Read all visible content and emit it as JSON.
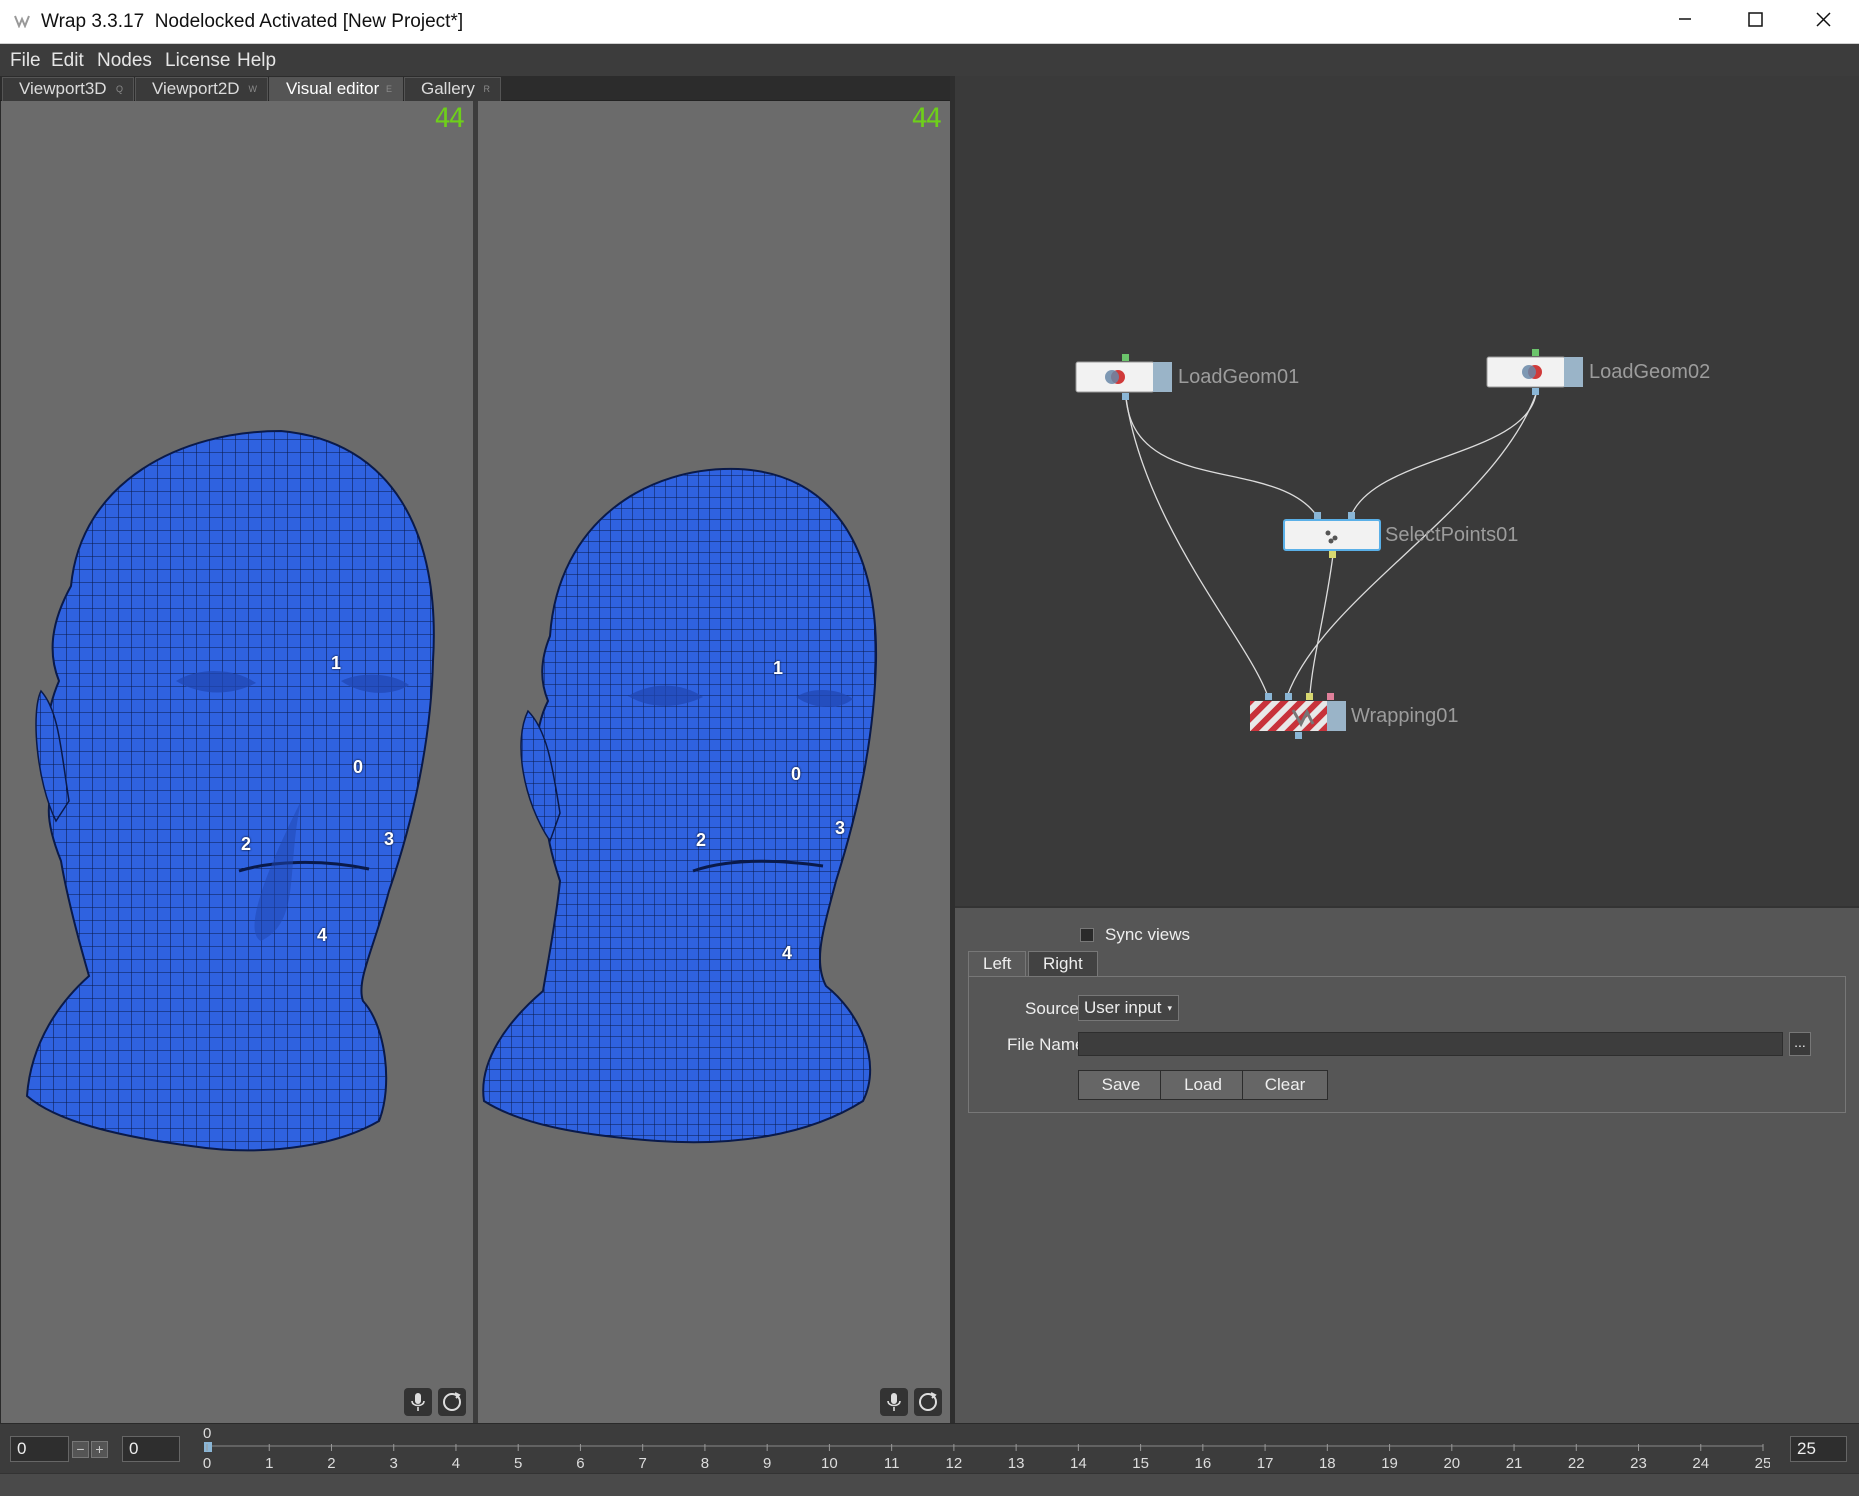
{
  "window": {
    "title": "Wrap 3.3.17  Nodelocked Activated [New Project*]"
  },
  "menu": [
    "File",
    "Edit",
    "Nodes",
    "License",
    "Help"
  ],
  "tabs": [
    {
      "label": "Viewport3D",
      "key": "Q"
    },
    {
      "label": "Viewport2D",
      "key": "W"
    },
    {
      "label": "Visual editor",
      "key": "E"
    },
    {
      "label": "Gallery",
      "key": "R"
    }
  ],
  "viewports": {
    "left": {
      "fps": "44",
      "points": [
        "0",
        "1",
        "2",
        "3",
        "4"
      ]
    },
    "right": {
      "fps": "44",
      "points": [
        "0",
        "1",
        "2",
        "3",
        "4"
      ]
    }
  },
  "nodes": {
    "load_geom_1": "LoadGeom01",
    "load_geom_2": "LoadGeom02",
    "select_points": "SelectPoints01",
    "wrapping": "Wrapping01"
  },
  "props": {
    "sync_views": "Sync views",
    "tab_left": "Left",
    "tab_right": "Right",
    "source_label": "Source",
    "source_value": "User input",
    "file_name_label": "File Name",
    "file_name_value": "",
    "browse": "...",
    "save": "Save",
    "load": "Load",
    "clear": "Clear"
  },
  "timeline": {
    "start": "0",
    "current": "0",
    "cursor": "0",
    "end": "25",
    "ticks": [
      "0",
      "1",
      "2",
      "3",
      "4",
      "5",
      "6",
      "7",
      "8",
      "9",
      "10",
      "11",
      "12",
      "13",
      "14",
      "15",
      "16",
      "17",
      "18",
      "19",
      "20",
      "21",
      "22",
      "23",
      "24",
      "25"
    ]
  }
}
